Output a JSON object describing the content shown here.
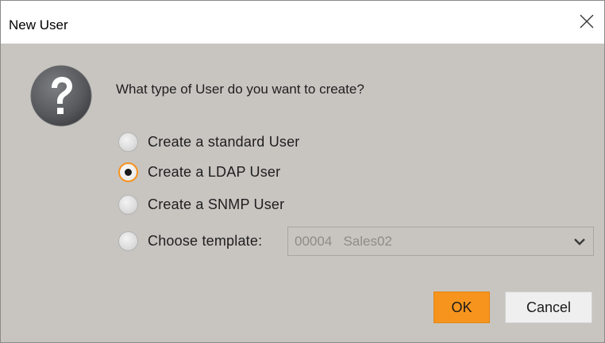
{
  "window": {
    "title": "New User",
    "close_icon": "close-icon"
  },
  "dialog": {
    "icon": "question-icon",
    "question": "What type of User do you want to create?",
    "options": [
      {
        "label": "Create a standard User",
        "checked": false
      },
      {
        "label": "Create a LDAP User",
        "checked": true
      },
      {
        "label": "Create a SNMP User",
        "checked": false
      },
      {
        "label": "Choose template:",
        "checked": false
      }
    ],
    "template_select": {
      "value": "00004   Sales02",
      "enabled": false,
      "icon": "chevron-down-icon"
    }
  },
  "buttons": {
    "ok_label": "OK",
    "cancel_label": "Cancel"
  },
  "colors": {
    "accent": "#f7941d",
    "dialog_bg": "#c8c5c1",
    "icon_gradient": "#56585b"
  }
}
